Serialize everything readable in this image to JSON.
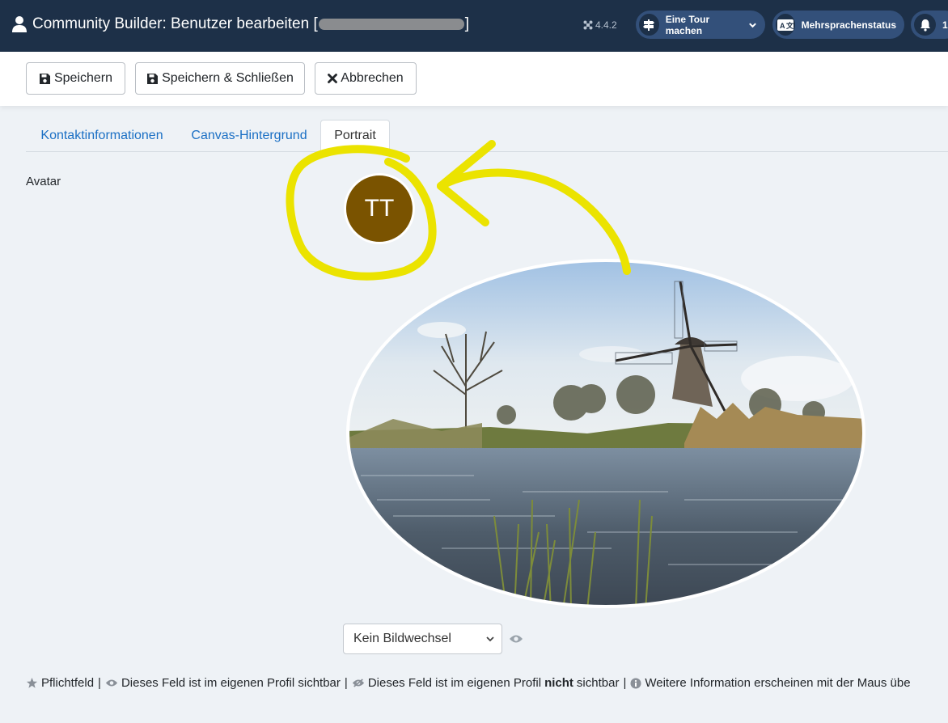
{
  "header": {
    "title_prefix": "Community Builder: Benutzer bearbeiten [",
    "title_suffix": "]",
    "version": "4.4.2",
    "tour_label": "Eine Tour machen",
    "lang_status_label": "Mehrsprachenstatus",
    "notification_count": "1",
    "bg_color": "#1d3048"
  },
  "toolbar": {
    "save_label": "Speichern",
    "save_close_label": "Speichern & Schließen",
    "cancel_label": "Abbrechen"
  },
  "tabs": [
    {
      "label": "Kontaktinformationen",
      "active": false
    },
    {
      "label": "Canvas-Hintergrund",
      "active": false
    },
    {
      "label": "Portrait",
      "active": true
    }
  ],
  "portrait": {
    "field_label": "Avatar",
    "avatar_initials": "TT",
    "avatar_color": "#7a5300",
    "image_select_value": "Kein Bildwechsel"
  },
  "legend": {
    "required": "Pflichtfeld",
    "visible": "Dieses Feld ist im eigenen Profil sichtbar",
    "not_visible_pre": "Dieses Feld ist im eigenen Profil",
    "not_visible_bold": "nicht",
    "not_visible_post": "sichtbar",
    "more_info": "Weitere Information erscheinen mit der Maus übe",
    "separator": "|"
  },
  "annotation": {
    "color": "#ebe300"
  }
}
